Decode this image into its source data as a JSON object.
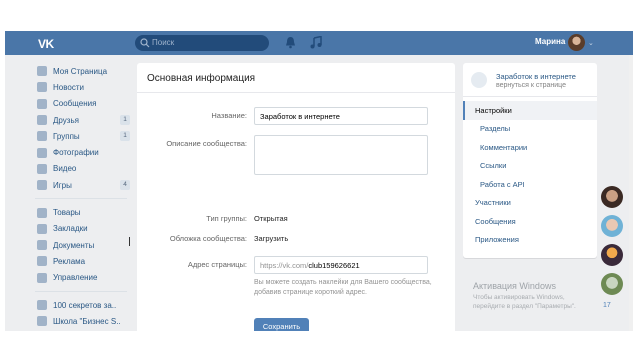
{
  "header": {
    "logo": "VK",
    "search_placeholder": "Поиск",
    "user_name": "Марина"
  },
  "sidebar": {
    "items": [
      {
        "label": "Моя Страница",
        "badge": ""
      },
      {
        "label": "Новости",
        "badge": ""
      },
      {
        "label": "Сообщения",
        "badge": ""
      },
      {
        "label": "Друзья",
        "badge": "1"
      },
      {
        "label": "Группы",
        "badge": "1"
      },
      {
        "label": "Фотографии",
        "badge": ""
      },
      {
        "label": "Видео",
        "badge": ""
      },
      {
        "label": "Игры",
        "badge": "4"
      }
    ],
    "items2": [
      {
        "label": "Товары"
      },
      {
        "label": "Закладки"
      },
      {
        "label": "Документы"
      },
      {
        "label": "Реклама"
      },
      {
        "label": "Управление"
      }
    ],
    "items3": [
      {
        "label": "100 секретов за.."
      },
      {
        "label": "Школа \"Бизнес S.."
      }
    ]
  },
  "main": {
    "title": "Основная информация",
    "name_label": "Название:",
    "name_value": "Заработок в интернете",
    "desc_label": "Описание сообщества:",
    "type_label": "Тип группы:",
    "type_value": "Открытая",
    "cover_label": "Обложка сообщества:",
    "cover_value": "Загрузить",
    "address_label": "Адрес страницы:",
    "address_prefix": "https://vk.com/",
    "address_value": "club159626621",
    "hint": "Вы можете создать наклейки для Вашего сообщества, добавив странице короткий адрес.",
    "save": "Сохранить"
  },
  "right": {
    "title": "Заработок в интернете",
    "subtitle": "вернуться к странице",
    "items": [
      {
        "label": "Настройки",
        "sub": false,
        "active": true
      },
      {
        "label": "Разделы",
        "sub": true,
        "active": false
      },
      {
        "label": "Комментарии",
        "sub": true,
        "active": false
      },
      {
        "label": "Ссылки",
        "sub": true,
        "active": false
      },
      {
        "label": "Работа с API",
        "sub": true,
        "active": false
      },
      {
        "label": "Участники",
        "sub": false,
        "active": false
      },
      {
        "label": "Сообщения",
        "sub": false,
        "active": false
      },
      {
        "label": "Приложения",
        "sub": false,
        "active": false
      }
    ]
  },
  "watermark": {
    "title": "Активация Windows",
    "text": "Чтобы активировать Windows, перейдите в раздел \"Параметры\"."
  },
  "chat": {
    "count": "17"
  },
  "colors": {
    "header": "#4a76a8",
    "accent": "#5181b8",
    "link": "#2a5885",
    "bg": "#edeef0"
  }
}
